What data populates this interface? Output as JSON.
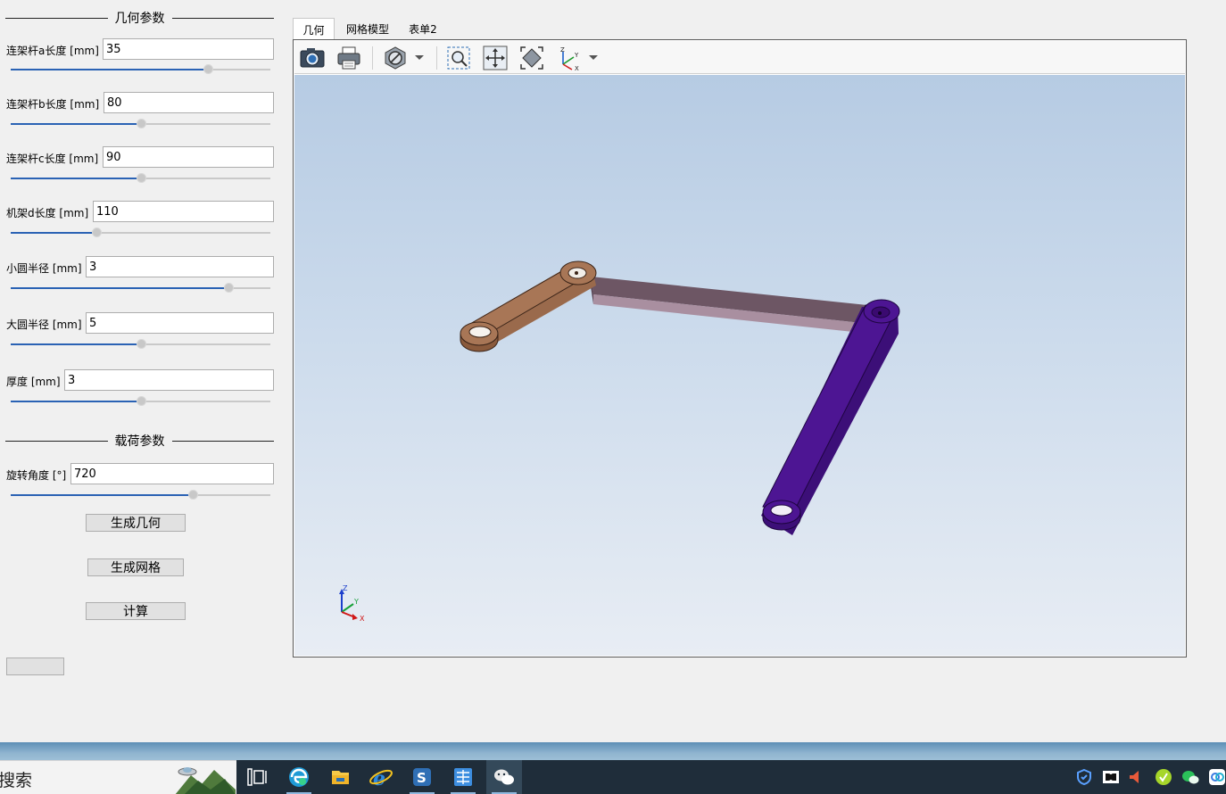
{
  "geometry_section": {
    "title": "几何参数"
  },
  "params": [
    {
      "label": "连架杆a长度 [mm]",
      "value": "35",
      "fraction": 0.76
    },
    {
      "label": "连架杆b长度 [mm]",
      "value": "80",
      "fraction": 0.5
    },
    {
      "label": "连架杆c长度 [mm]",
      "value": "90",
      "fraction": 0.5
    },
    {
      "label": "机架d长度 [mm]",
      "value": "110",
      "fraction": 0.33
    },
    {
      "label": "小圆半径 [mm]",
      "value": "3",
      "fraction": 0.84
    },
    {
      "label": "大圆半径 [mm]",
      "value": "5",
      "fraction": 0.5
    },
    {
      "label": "厚度 [mm]",
      "value": "3",
      "fraction": 0.5
    }
  ],
  "load_section": {
    "title": "载荷参数"
  },
  "rotation": {
    "label": "旋转角度 [°]",
    "value": "720",
    "fraction": 0.7
  },
  "buttons": {
    "generate_geometry": "生成几何",
    "generate_mesh": "生成网格",
    "compute": "计算",
    "extra": ""
  },
  "tabs": [
    {
      "label": "几何",
      "active": true
    },
    {
      "label": "网格模型",
      "active": false
    },
    {
      "label": "表单2",
      "active": false
    }
  ],
  "toolbar_icons": [
    "camera-icon",
    "printer-icon",
    "display-mode-icon",
    "zoom-box-icon",
    "pan-icon",
    "fit-all-icon",
    "axis-view-icon"
  ],
  "axis": {
    "z": "Z",
    "y": "Y",
    "x": "X"
  },
  "colors": {
    "link_a": "#8a5a3c",
    "link_b": "#7a5868",
    "link_c": "#4a1390",
    "accent": "#2a62b4"
  },
  "taskbar": {
    "search_text": "搜索",
    "apps": [
      "task-view-icon",
      "edge-icon",
      "file-explorer-icon",
      "ie-icon",
      "app-s-icon",
      "app-book-icon",
      "wechat-icon"
    ]
  }
}
